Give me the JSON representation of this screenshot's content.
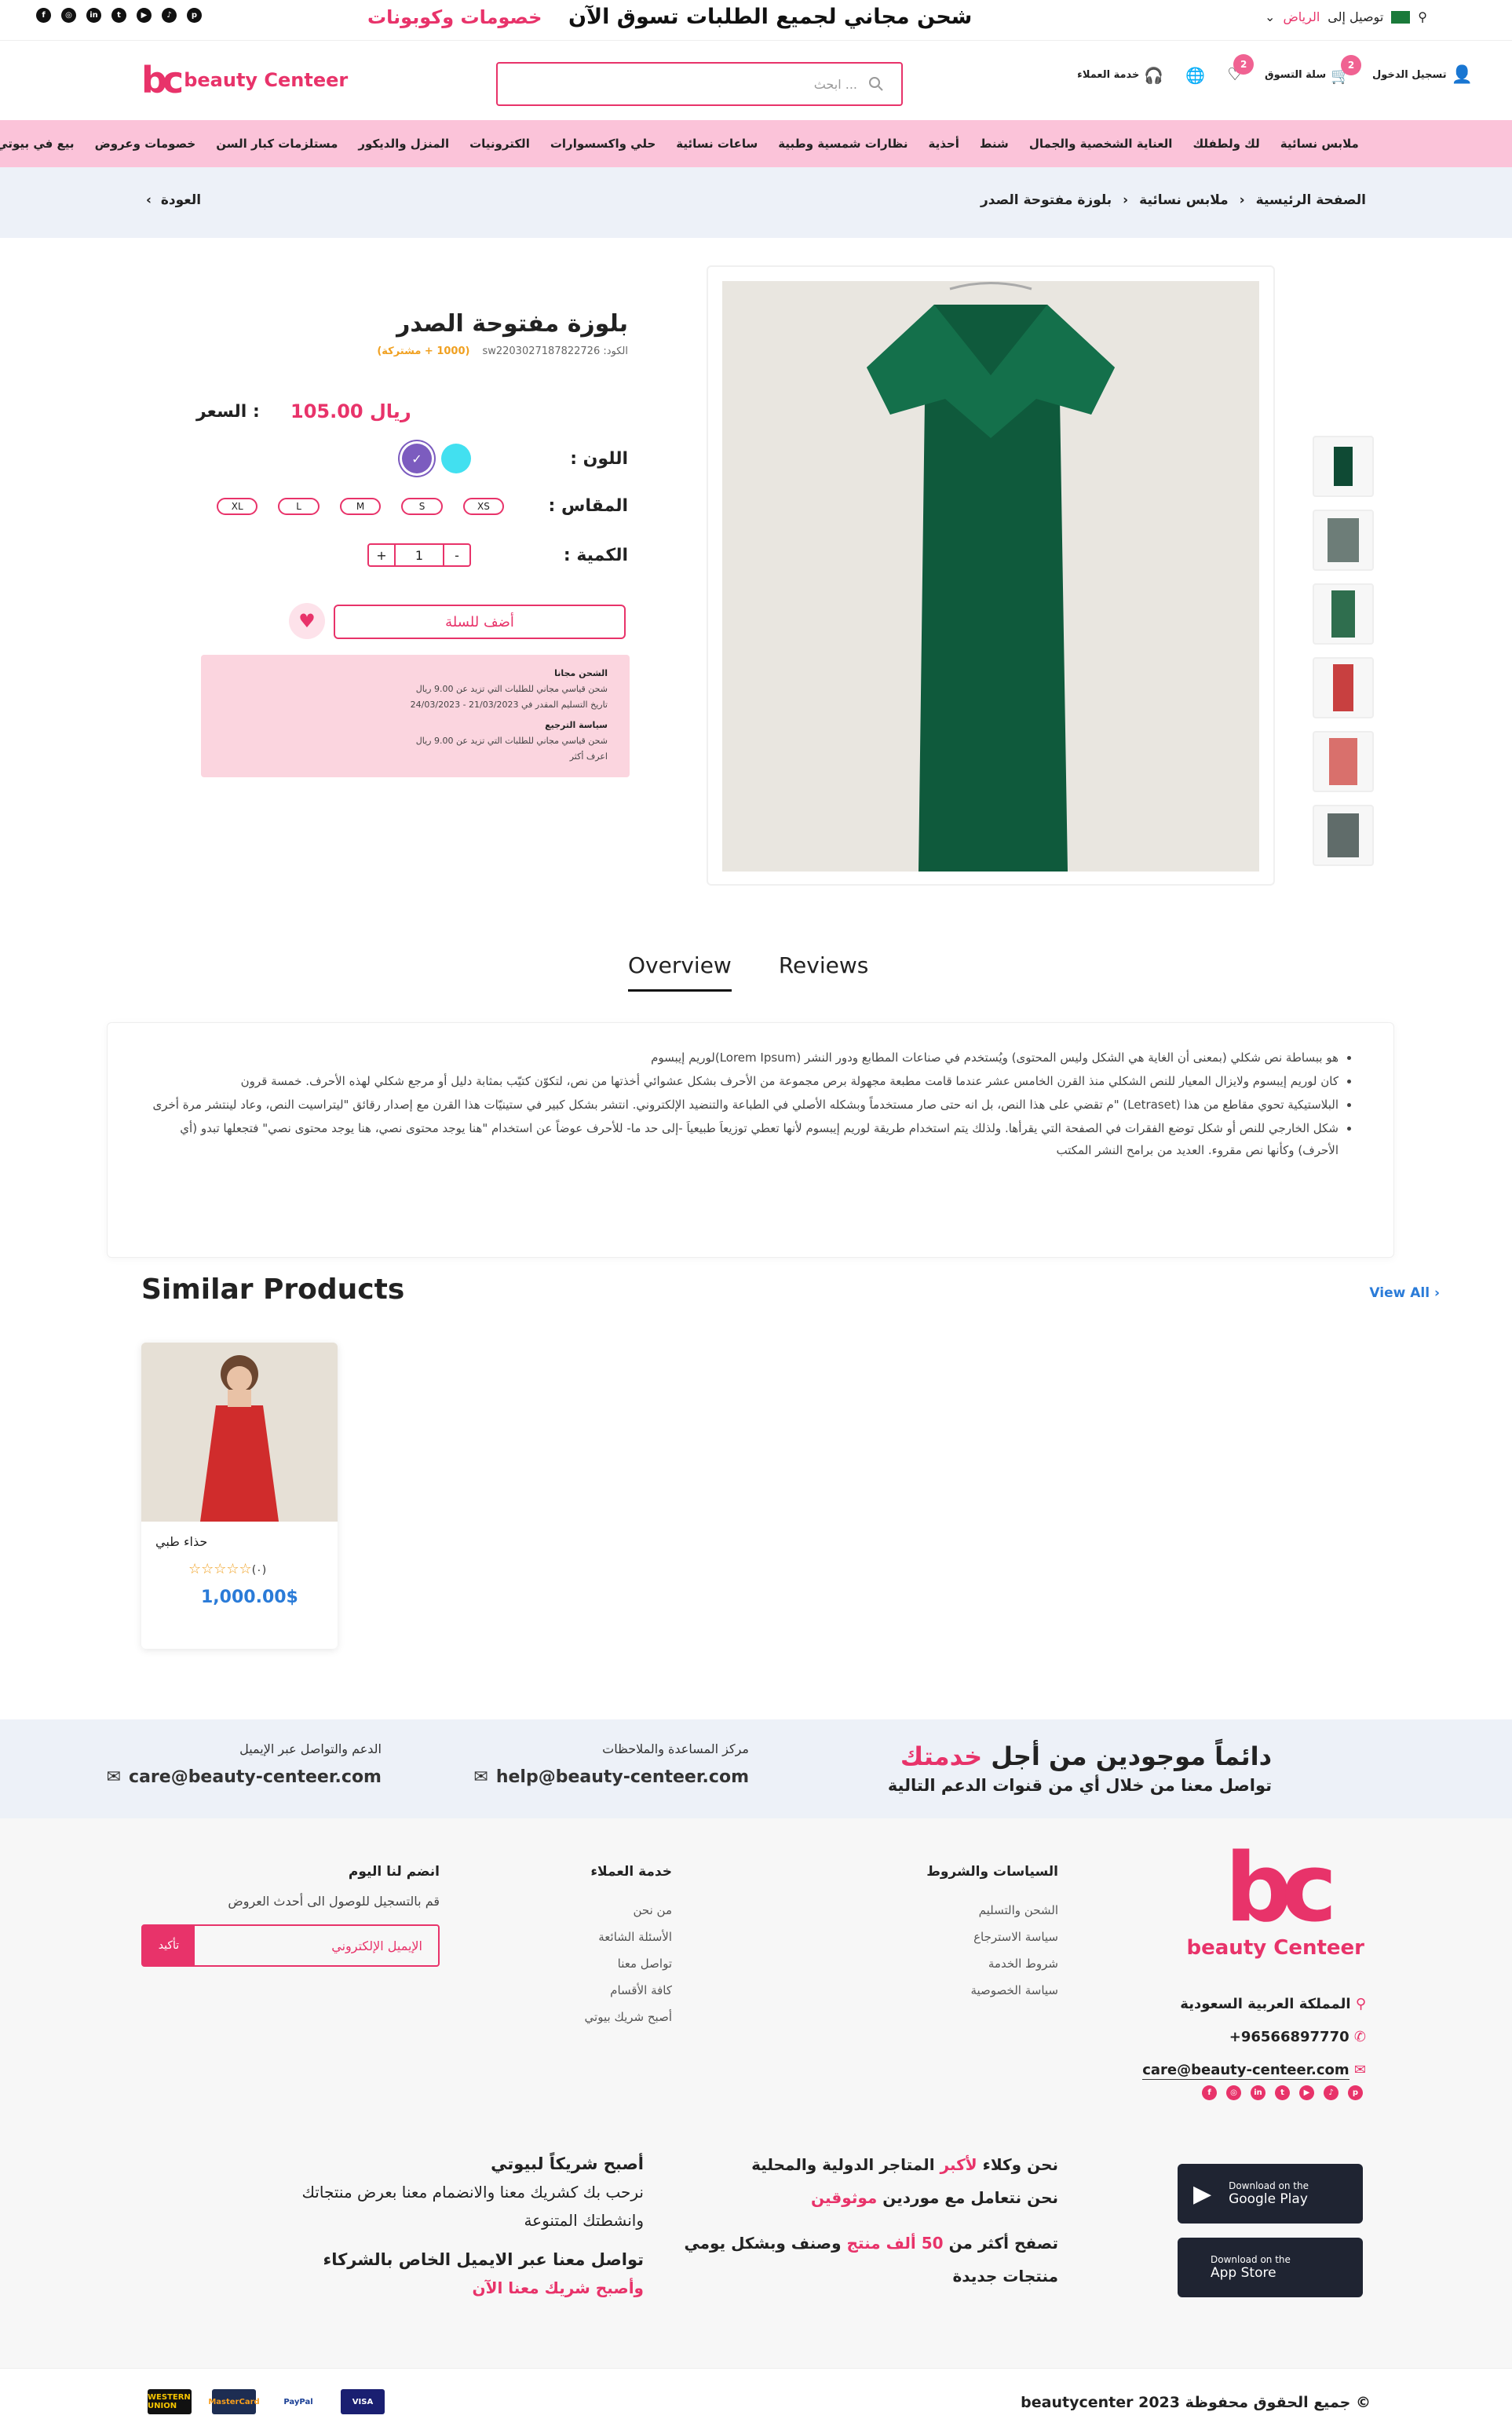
{
  "topbar": {
    "social_icons": [
      "facebook-icon",
      "instagram-icon",
      "linkedin-icon",
      "twitter-icon",
      "youtube-icon",
      "tiktok-icon",
      "pinterest-icon"
    ],
    "promo": "خصومات وكوبونات",
    "shipping": "شحن مجاني لجميع الطلبات تسوق الآن",
    "deliver_to": "توصيل إلى",
    "city": "الرياض"
  },
  "header": {
    "logo_text": "beauty Centeer",
    "search_placeholder": "ابحث ...",
    "customer_service": "خدمة العملاء",
    "wishlist_count": "2",
    "cart_label": "سلة التسوق",
    "cart_count": "2",
    "login": "تسجيل الدخول"
  },
  "nav": [
    "ملابس نسائية",
    "لك ولطفلك",
    "العناية الشخصية والجمال",
    "شنط",
    "أحذية",
    "نظارات شمسية وطبية",
    "ساعات نسائية",
    "حلي واكسسوارات",
    "الكترونيات",
    "المنزل والديكور",
    "مستلزمات كبار السن",
    "خصومات وعروض",
    "بيع في بيوتي"
  ],
  "breadcrumb": {
    "items": [
      "الصفحة الرئيسية",
      "ملابس نسائية",
      "بلوزة مفتوحة الصدر"
    ],
    "back": "العودة"
  },
  "product": {
    "title": "بلوزة مفتوحة الصدر",
    "code_label": "الكود: sw2203027187822726",
    "points": "(1000 + مشتركة)",
    "price_label": "السعر :",
    "price": "105.00 ريال",
    "color_label": "اللون :",
    "colors": [
      "#7c5cbf",
      "#42e0f0"
    ],
    "size_label": "المقاس :",
    "sizes": [
      "XS",
      "S",
      "M",
      "L",
      "XL"
    ],
    "qty_label": "الكمية :",
    "qty": "1",
    "add_to_cart": "أضف للسلة",
    "notice": {
      "free_title": "الشحن مجانا",
      "free_line1": "شحن قياسي مجاني للطلبات التي تزيد عن 9.00 ريال",
      "free_line2": "تاريخ التسليم المقدر في 21/03/2023 - 24/03/2023",
      "return_title": "سياسة الترجيع",
      "return_line1": "شحن قياسي مجاني للطلبات التي تزيد عن 9.00 ريال",
      "return_more": "اعرف أكثر"
    }
  },
  "tabs": {
    "overview": "Overview",
    "reviews": "Reviews"
  },
  "description": [
    "هو ببساطة نص شكلي (بمعنى أن الغاية هي الشكل وليس المحتوى) ويُستخدم في صناعات المطابع ودور النشر (Lorem Ipsum)لوريم إيبسوم",
    "كان لوريم إيبسوم ولايزال المعيار للنص الشكلي منذ القرن الخامس عشر عندما قامت مطبعة مجهولة برص مجموعة من الأحرف بشكل عشوائي أخذتها من نص، لتكوّن كتيّب بمثابة دليل أو مرجع شكلي لهذه الأحرف. خمسة قرون",
    "البلاستيكية تحوي مقاطع من هذا (Letraset) \"م تقضي على هذا النص، بل انه حتى صار مستخدماً وبشكله الأصلي في الطباعة والتنضيد الإلكتروني. انتشر بشكل كبير في ستينيّات هذا القرن مع إصدار رقائق \"ليتراسيت النص، وعاد لينتشر مرة أخرى",
    "شكل الخارجي للنص أو شكل توضع الفقرات في الصفحة التي يقرأها. ولذلك يتم استخدام طريقة لوريم إيبسوم لأنها تعطي توزيعاَ طبيعياَ -إلى حد ما- للأحرف عوضاً عن استخدام \"هنا يوجد محتوى نصي، هنا يوجد محتوى نصي\" فتجعلها تبدو (أي الأحرف) وكأنها نص مقروء. العديد من برامح النشر المكتب"
  ],
  "similar": {
    "title": "Similar Products",
    "view_all": "View All",
    "items": [
      {
        "name": "حذاء طبي",
        "reviews": "(٠)",
        "price": "1,000.00$"
      }
    ]
  },
  "support": {
    "heading_a": "دائماً موجودين من أجل",
    "heading_b": "خدمتك",
    "sub": "تواصل معنا من خلال أي من قنوات الدعم التالية",
    "help_label": "مركز المساعدة والملاحظات",
    "help_email": "help@beauty-centeer.com",
    "care_label": "الدعم والتواصل عبر الإيميل",
    "care_email": "care@beauty-centeer.com"
  },
  "footer": {
    "logo_text": "beauty Centeer",
    "country": "المملكة العربية السعودية",
    "phone": "+96566897770",
    "email": "care@beauty-centeer.com",
    "policies_title": "السياسات والشروط",
    "policies": [
      "الشحن والتسليم",
      "سياسة الاسترجاع",
      "شروط الخدمة",
      "سياسة الخصوصية"
    ],
    "service_title": "خدمة العملاء",
    "service": [
      "من نحن",
      "الأسئلة الشائعة",
      "تواصل معنا",
      "كافة الأقسام",
      "أصبح شريك بيوتي"
    ],
    "join_title": "انضم لنا اليوم",
    "join_text": "قم بالتسجيل للوصول الى أحدث العروض",
    "email_placeholder": "الإيميل الإلكتروني",
    "confirm": "تأكيد",
    "agents_a": "نحن وكلاء",
    "agents_b": "لأكبر",
    "agents_c": "المتاجر الدولية والمحلية",
    "trusted_a": "نحن نتعامل مع موردين",
    "trusted_b": "موثوقين",
    "browse_a": "تصفح أكثر من",
    "browse_b": "50 ألف منتج",
    "browse_c": "وصنف وبشكل يومي",
    "browse_d": "منتجات جديدة",
    "partner_title": "أصبح شريكاً لبيوتي",
    "partner_text": "نرحب بك كشريك معنا والانضمام معنا بعرض منتجاتك وانشطتك المتنوعة",
    "contact_title": "تواصل معنا عبر الايميل الخاص بالشركاء",
    "contact_link": "وأصبح شريك معنا الآن",
    "google_small": "Download on the",
    "google_big": "Google Play",
    "apple_small": "Download on the",
    "apple_big": "App Store",
    "payments": [
      "WESTERN UNION",
      "MasterCard",
      "PayPal",
      "VISA"
    ],
    "copyright": "© جميع الحقوق محفوظة beautycenter 2023"
  }
}
